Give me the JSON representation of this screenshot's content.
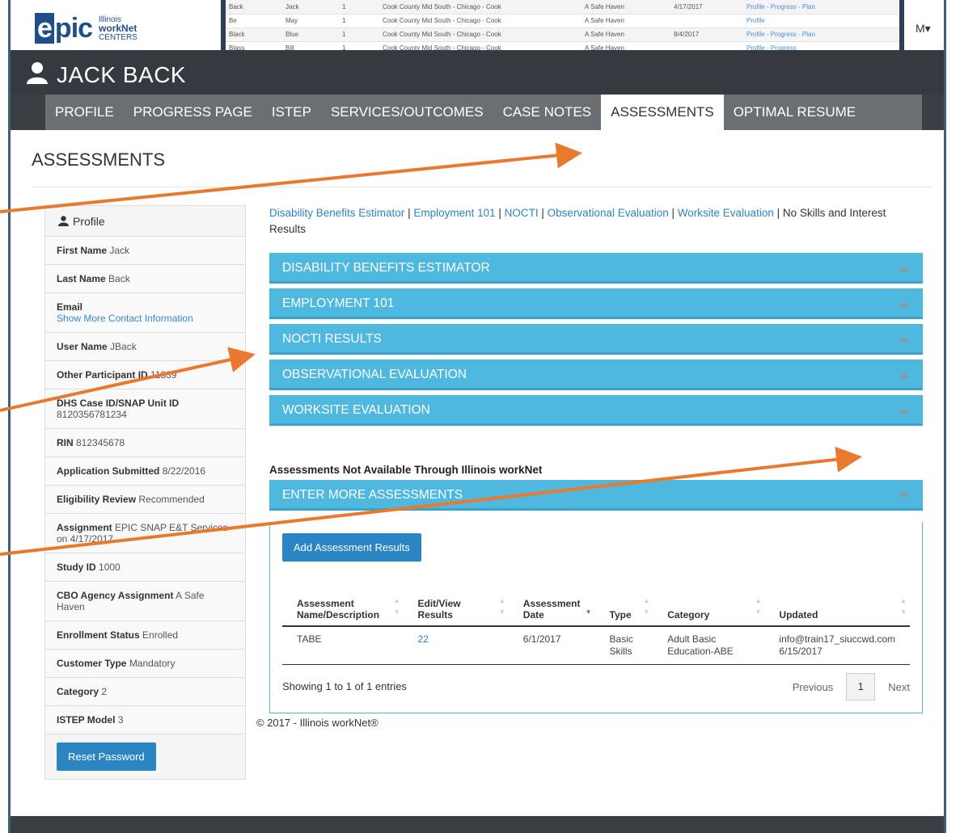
{
  "logo": {
    "brand": "epic",
    "brand_first": "e",
    "brand_rest": "pic",
    "sub_line1": "Illinois",
    "sub_line2": "workNet",
    "sub_line3": "CENTERS"
  },
  "user_menu": {
    "label": "M"
  },
  "overlay_rows": [
    [
      "Back",
      "Jack",
      "1",
      "Cook County Mid South - Chicago - Cook",
      "A Safe Haven",
      "4/17/2017",
      "Profile - Progress - Plan"
    ],
    [
      "Be",
      "May",
      "1",
      "Cook County Mid South - Chicago - Cook",
      "A Safe Haven",
      "",
      "Profile"
    ],
    [
      "Black",
      "Blue",
      "1",
      "Cook County Mid South - Chicago - Cook",
      "A Safe Haven",
      "8/4/2017",
      "Profile - Progress - Plan"
    ],
    [
      "Blass",
      "Bill",
      "1",
      "Cook County Mid South - Chicago - Cook",
      "A Safe Haven",
      "",
      "Profile - Progress"
    ]
  ],
  "participant": {
    "name": "JACK BACK"
  },
  "tabs": [
    {
      "label": "PROFILE",
      "active": false
    },
    {
      "label": "PROGRESS PAGE",
      "active": false
    },
    {
      "label": "ISTEP",
      "active": false
    },
    {
      "label": "SERVICES/OUTCOMES",
      "active": false
    },
    {
      "label": "CASE NOTES",
      "active": false
    },
    {
      "label": "ASSESSMENTS",
      "active": true
    },
    {
      "label": "OPTIMAL RESUME",
      "active": false
    }
  ],
  "page_title": "ASSESSMENTS",
  "sidebar": {
    "heading": "Profile",
    "rows": [
      {
        "label": "First Name",
        "value": "Jack"
      },
      {
        "label": "Last Name",
        "value": "Back"
      },
      {
        "label": "Email",
        "value": "",
        "link": "Show More Contact Information"
      },
      {
        "label": "User Name",
        "value": "JBack"
      },
      {
        "label": "Other Participant ID",
        "value": "11839"
      },
      {
        "label": "DHS Case ID/SNAP Unit ID",
        "value": "8120356781234"
      },
      {
        "label": "RIN",
        "value": "812345678"
      },
      {
        "label": "Application Submitted",
        "value": "8/22/2016"
      },
      {
        "label": "Eligibility Review",
        "value": "Recommended"
      },
      {
        "label": "Assignment",
        "value": "EPIC SNAP E&T Services on 4/17/2017"
      },
      {
        "label": "Study ID",
        "value": "1000"
      },
      {
        "label": "CBO Agency Assignment",
        "value": "A Safe Haven"
      },
      {
        "label": "Enrollment Status",
        "value": "Enrolled"
      },
      {
        "label": "Customer Type",
        "value": "Mandatory"
      },
      {
        "label": "Category",
        "value": "2"
      },
      {
        "label": "ISTEP Model",
        "value": "3"
      }
    ],
    "reset_button": "Reset Password"
  },
  "quick_links": {
    "l1": "Disability Benefits Estimator",
    "l2": "Employment 101",
    "l3": "NOCTI",
    "l4": "Observational Evaluation",
    "l5": "Worksite Evaluation",
    "sep": " | ",
    "tail": "No Skills and Interest Results"
  },
  "accordions": [
    "DISABILITY BENEFITS ESTIMATOR",
    "EMPLOYMENT 101",
    "NOCTI RESULTS",
    "OBSERVATIONAL EVALUATION",
    "WORKSITE EVALUATION"
  ],
  "external_section": {
    "title": "Assessments Not Available Through Illinois workNet",
    "accordion": "ENTER MORE ASSESSMENTS",
    "add_button": "Add Assessment Results",
    "columns": {
      "name1": "Assessment",
      "name2": "Name/Description",
      "edit1": "Edit/View",
      "edit2": "Results",
      "date1": "Assessment",
      "date2": "Date",
      "type": "Type",
      "category": "Category",
      "updated": "Updated"
    },
    "row": {
      "name": "TABE",
      "edit": "22",
      "date": "6/1/2017",
      "type1": "Basic",
      "type2": "Skills",
      "cat1": "Adult Basic",
      "cat2": "Education-ABE",
      "updated1": "info@train17_siuccwd.com",
      "updated2": "6/15/2017"
    },
    "showing": "Showing 1 to 1 of 1 entries",
    "prev": "Previous",
    "page": "1",
    "next": "Next"
  },
  "footer": "© 2017 - Illinois workNet®",
  "colors": {
    "accent": "#4fb8de",
    "button": "#2a85c2",
    "arrow": "#e8792f",
    "dark": "#343a40",
    "tabbar": "#6b6f72"
  }
}
